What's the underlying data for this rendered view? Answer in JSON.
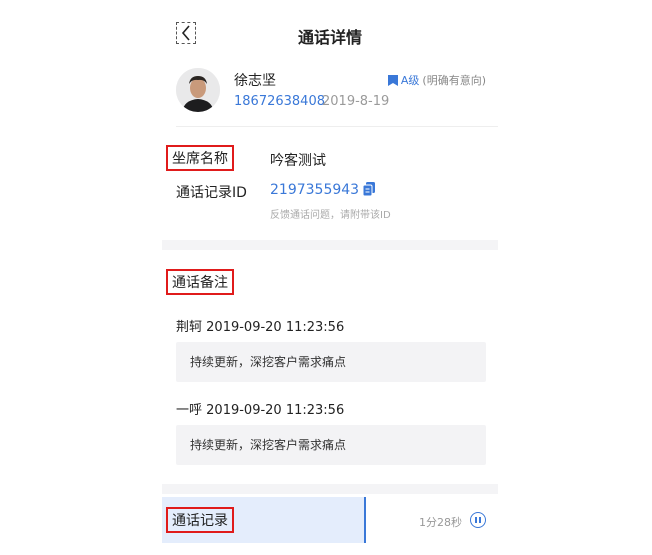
{
  "header": {
    "title": "通话详情",
    "back_icon": "chevron-left-icon"
  },
  "profile": {
    "name": "徐志坚",
    "phone": "18672638408",
    "date": "2019-8-19",
    "level": "A级",
    "level_note": "(明确有意向)",
    "level_icon": "bookmark-icon"
  },
  "info": {
    "agent_label": "坐席名称",
    "agent_value": "吟客测试",
    "callid_label": "通话记录ID",
    "callid_value": "2197355943",
    "copy_icon": "copy-icon",
    "hint": "反馈通话问题，请附带该ID"
  },
  "notes": {
    "label": "通话备注",
    "items": [
      {
        "author": "荆轲",
        "time": "2019-09-20 11:23:56",
        "content": "持续更新，深挖客户需求痛点"
      },
      {
        "author": "一呼",
        "time": "2019-09-20 11:23:56",
        "content": "持续更新，深挖客户需求痛点"
      }
    ]
  },
  "recording": {
    "label": "通话记录",
    "duration": "1分28秒",
    "progress": 0.6,
    "control_icon": "pause-icon"
  },
  "colors": {
    "accent": "#3a78d8",
    "highlight_border": "#e01b1b"
  }
}
